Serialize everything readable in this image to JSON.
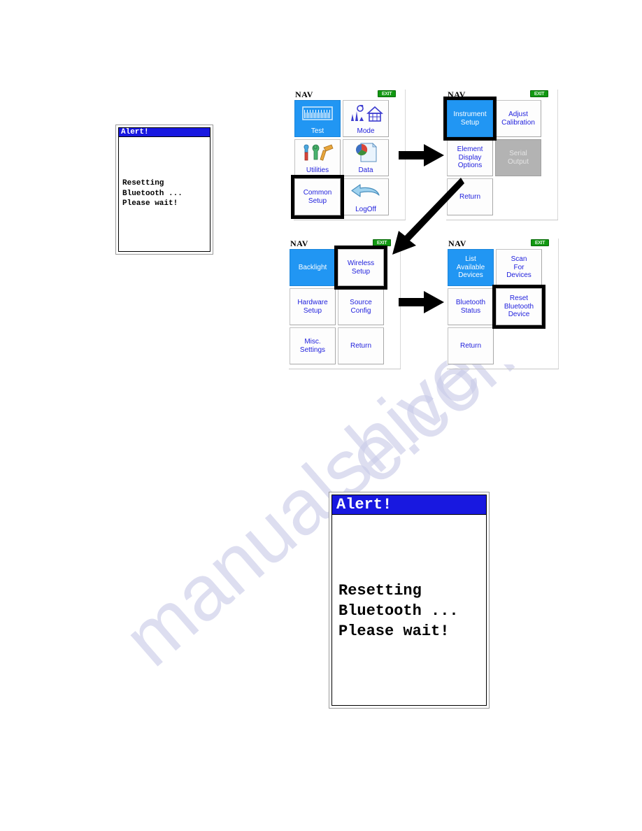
{
  "page": {
    "watermark": [
      "manualshive",
      "e.com"
    ]
  },
  "alert_small": {
    "name": "alert-dialog-small",
    "title": "Alert!",
    "message": "Resetting\nBluetooth ...\nPlease wait!"
  },
  "alert_large": {
    "name": "alert-dialog-large",
    "title": "Alert!",
    "message": "Resetting\nBluetooth ...\nPlease wait!"
  },
  "colors": {
    "selected_blue": "#2196f3",
    "label_blue": "#2222dd",
    "title_blue": "#1818e0",
    "disabled_gray": "#b3b3b3",
    "exit_green": "#119911",
    "highlight_black": "#000000"
  },
  "nav_screens": [
    {
      "id": "nav-main",
      "header": "NAV",
      "exit_badge": "EXIT",
      "buttons": [
        {
          "label": "Test",
          "icon": "ruler-scale-icon",
          "state": "selected",
          "highlight": false
        },
        {
          "label": "Mode",
          "icon": "chimney-house-icon",
          "state": "normal",
          "highlight": false
        },
        {
          "label": "Utilities",
          "icon": "tools-icon",
          "state": "normal",
          "highlight": false
        },
        {
          "label": "Data",
          "icon": "pie-document-icon",
          "state": "normal",
          "highlight": false
        },
        {
          "label": "Common\nSetup",
          "icon": "",
          "state": "normal",
          "highlight": true
        },
        {
          "label": "LogOff",
          "icon": "back-arrow-icon",
          "state": "normal",
          "highlight": false
        }
      ]
    },
    {
      "id": "nav-common-setup",
      "header": "NAV",
      "exit_badge": "EXIT",
      "buttons": [
        {
          "label": "Instrument\nSetup",
          "icon": "",
          "state": "selected",
          "highlight": true
        },
        {
          "label": "Adjust\nCalibration",
          "icon": "",
          "state": "normal",
          "highlight": false
        },
        {
          "label": "Element\nDisplay\nOptions",
          "icon": "",
          "state": "normal",
          "highlight": false
        },
        {
          "label": "Serial\nOutput",
          "icon": "",
          "state": "disabled",
          "highlight": false
        },
        {
          "label": "Return",
          "icon": "",
          "state": "normal",
          "highlight": false
        },
        {
          "label": "",
          "icon": "",
          "state": "empty",
          "highlight": false
        }
      ]
    },
    {
      "id": "nav-instrument-setup",
      "header": "NAV",
      "exit_badge": "EXIT",
      "buttons": [
        {
          "label": "Backlight",
          "icon": "",
          "state": "selected",
          "highlight": false
        },
        {
          "label": "Wireless\nSetup",
          "icon": "",
          "state": "normal",
          "highlight": true
        },
        {
          "label": "Hardware\nSetup",
          "icon": "",
          "state": "normal",
          "highlight": false
        },
        {
          "label": "Source\nConfig",
          "icon": "",
          "state": "normal",
          "highlight": false
        },
        {
          "label": "Misc.\nSettings",
          "icon": "",
          "state": "normal",
          "highlight": false
        },
        {
          "label": "Return",
          "icon": "",
          "state": "normal",
          "highlight": false
        }
      ]
    },
    {
      "id": "nav-wireless-setup",
      "header": "NAV",
      "exit_badge": "EXIT",
      "buttons": [
        {
          "label": "List\nAvailable\nDevices",
          "icon": "",
          "state": "selected",
          "highlight": false
        },
        {
          "label": "Scan\nFor\nDevices",
          "icon": "",
          "state": "normal",
          "highlight": false
        },
        {
          "label": "Bluetooth\nStatus",
          "icon": "",
          "state": "normal",
          "highlight": false
        },
        {
          "label": "Reset\nBluetooth\nDevice",
          "icon": "",
          "state": "normal",
          "highlight": true
        },
        {
          "label": "Return",
          "icon": "",
          "state": "normal",
          "highlight": false
        },
        {
          "label": "",
          "icon": "",
          "state": "empty",
          "highlight": false
        }
      ]
    }
  ],
  "arrows": [
    {
      "name": "arrow-main-to-common-setup",
      "direction": "right"
    },
    {
      "name": "arrow-common-to-instrument-setup",
      "direction": "diagonal-down-left"
    },
    {
      "name": "arrow-instrument-to-wireless",
      "direction": "right"
    }
  ]
}
